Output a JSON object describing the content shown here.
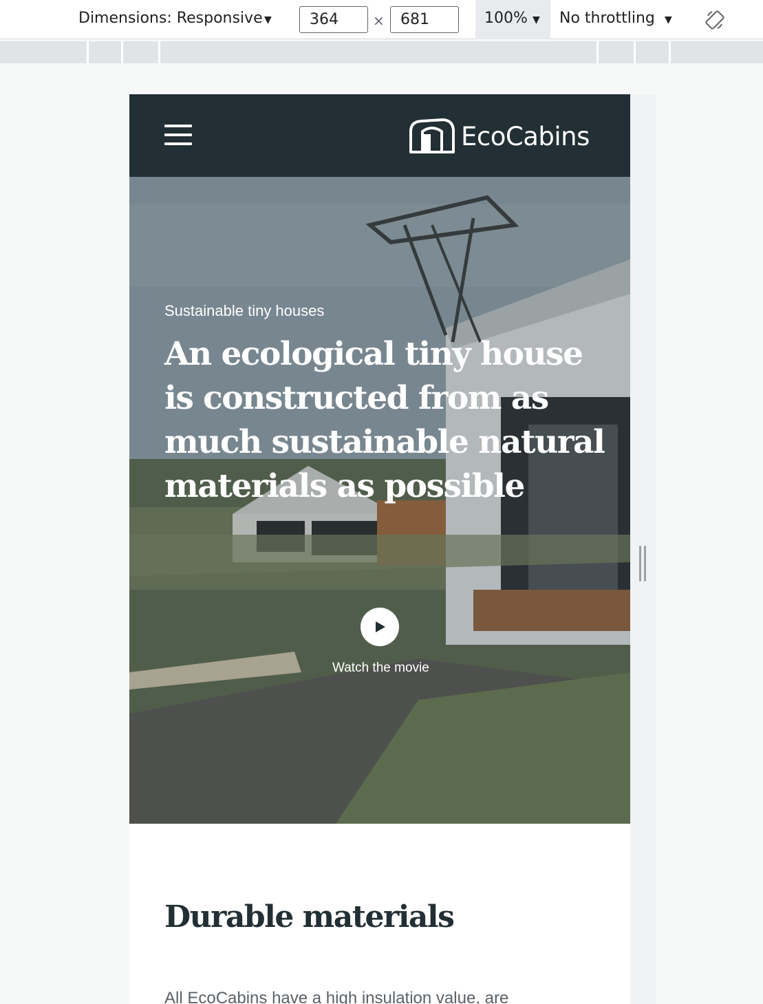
{
  "devtools": {
    "dimensions_label": "Dimensions: Responsive",
    "width_value": "364",
    "height_value": "681",
    "times_symbol": "×",
    "zoom_label": "100%",
    "throttling_label": "No throttling",
    "caret": "▼",
    "icons": [
      "dropdown-caret-icon",
      "rotate-icon",
      "resize-handle-icon"
    ]
  },
  "site": {
    "brand": "EcoCabins",
    "icons": [
      "hamburger-menu-icon",
      "cabin-logo-icon",
      "play-icon"
    ]
  },
  "hero": {
    "subtitle": "Sustainable tiny houses",
    "title": "An ecological tiny house is constructed from as much sustainable natural materials as possible",
    "watch_label": "Watch the movie"
  },
  "section": {
    "title": "Durable materials",
    "text": "All EcoCabins have a high insulation value, are"
  }
}
